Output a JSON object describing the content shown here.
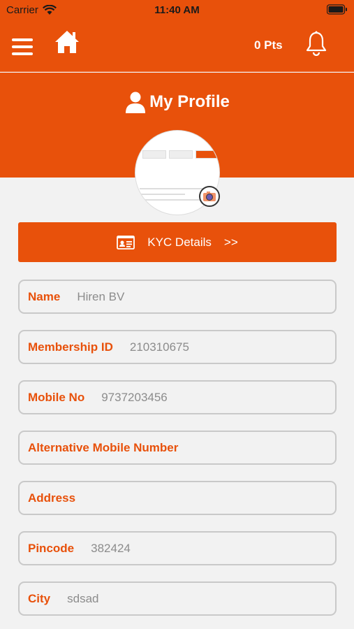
{
  "status_bar": {
    "carrier": "Carrier",
    "time": "11:40 AM"
  },
  "header": {
    "points": "0 Pts"
  },
  "profile": {
    "title": "My Profile"
  },
  "kyc": {
    "label": "KYC Details",
    "arrow": ">>"
  },
  "fields": [
    {
      "label": "Name",
      "value": "Hiren BV"
    },
    {
      "label": "Membership ID",
      "value": "210310675"
    },
    {
      "label": "Mobile No",
      "value": "9737203456"
    },
    {
      "label": "Alternative Mobile Number",
      "value": ""
    },
    {
      "label": "Address",
      "value": ""
    },
    {
      "label": "Pincode",
      "value": "382424"
    },
    {
      "label": "City",
      "value": "sdsad"
    }
  ],
  "colors": {
    "brand": "#e8510b",
    "background": "#f2f2f2",
    "field_border": "#c9c9c9",
    "value_text": "#8c8c8c"
  },
  "icons": [
    "wifi-icon",
    "battery-icon",
    "menu-icon",
    "home-icon",
    "bell-icon",
    "user-icon",
    "camera-icon",
    "id-card-icon"
  ]
}
